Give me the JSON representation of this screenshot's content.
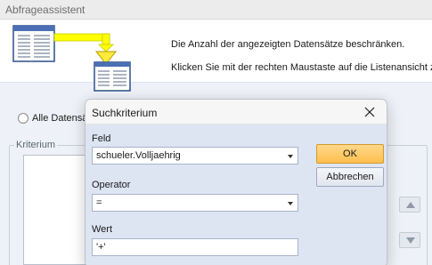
{
  "wizard": {
    "title": "Abfrageassistent",
    "description_line1": "Die Anzahl der angezeigten Datensätze beschränken.",
    "description_line2": "Klicken Sie mit der rechten Maustaste auf die Listenansicht zu",
    "radio_all_label": "Alle Datensätze",
    "criteria_group_label": "Kriterium",
    "illustration_icons": [
      "table-icon",
      "funnel-icon",
      "table-icon"
    ]
  },
  "dialog": {
    "title": "Suchkriterium",
    "close_icon": "close-icon",
    "field": {
      "label": "Feld",
      "value": "schueler.Volljaehrig"
    },
    "operator": {
      "label": "Operator",
      "value": "="
    },
    "value": {
      "label": "Wert",
      "value": "'+'"
    },
    "ok_label": "OK",
    "cancel_label": "Abbrechen"
  },
  "colors": {
    "dialog_body": "#dde5f3",
    "ok_button": "#fdbf4d",
    "arrow_yellow": "#ffff00",
    "wizard_lower": "#eef2f8"
  }
}
